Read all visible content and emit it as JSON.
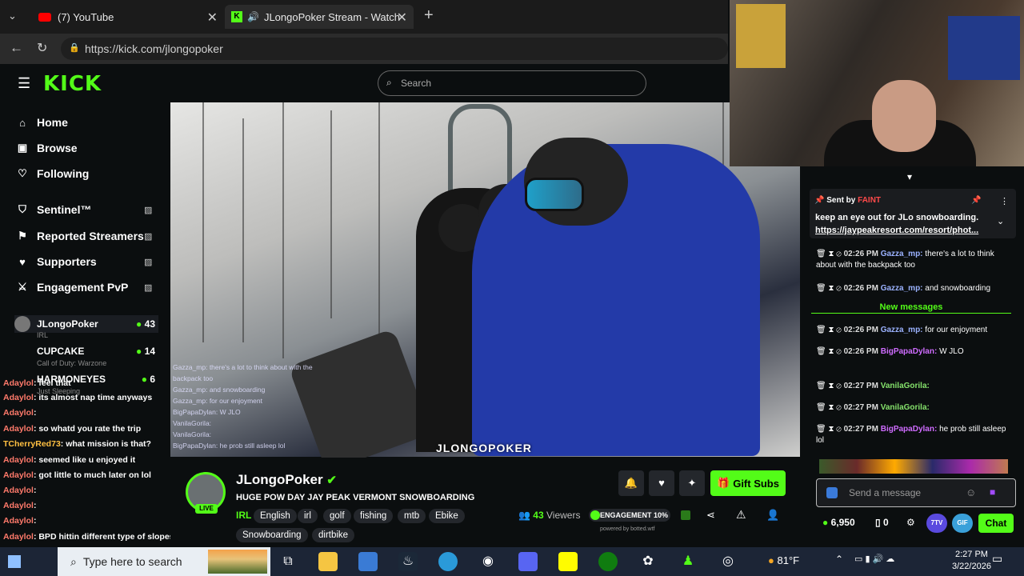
{
  "browser": {
    "tabs": [
      {
        "label": "(7) YouTube"
      },
      {
        "label": "JLongoPoker Stream - Watch"
      }
    ],
    "url": "https://kick.com/jlongopoker"
  },
  "kick": {
    "logo": "KICK",
    "search_placeholder": "Search",
    "nav": [
      {
        "label": "Home",
        "icon": "home-icon"
      },
      {
        "label": "Browse",
        "icon": "browse-icon"
      },
      {
        "label": "Following",
        "icon": "heart-icon"
      }
    ],
    "tools": [
      {
        "label": "Sentinel™",
        "icon": "shield-icon"
      },
      {
        "label": "Reported Streamers",
        "icon": "flag-icon"
      },
      {
        "label": "Supporters",
        "icon": "heart-icon"
      },
      {
        "label": "Engagement PvP",
        "icon": "swords-icon"
      }
    ],
    "channels": [
      {
        "name": "JLongoPoker",
        "sub": "IRL",
        "viewers": "43"
      },
      {
        "name": "CUPCAKE",
        "sub": "Call of Duty: Warzone",
        "viewers": "14"
      },
      {
        "name": "HARMONEYES",
        "sub": "Just Sleeping",
        "viewers": "6"
      }
    ]
  },
  "side_chat": [
    {
      "user": "Adaylol",
      "text": ": feel that"
    },
    {
      "user": "Adaylol",
      "text": ": its almost nap time anyways"
    },
    {
      "user": "Adaylol",
      "text": ":"
    },
    {
      "user": "Adaylol",
      "text": ": so whatd you rate the trip"
    },
    {
      "user": "TCherryRed73",
      "text": ": what mission is that?"
    },
    {
      "user": "Adaylol",
      "text": ": seemed like u enjoyed it"
    },
    {
      "user": "Adaylol",
      "text": ": got little to much later on lol"
    },
    {
      "user": "Adaylol",
      "text": ":"
    },
    {
      "user": "Adaylol",
      "text": ":"
    },
    {
      "user": "Adaylol",
      "text": ":"
    },
    {
      "user": "Adaylol",
      "text": ": BPD hittin different type of slopes"
    },
    {
      "user": "Adaylol",
      "text": ":"
    }
  ],
  "video": {
    "watermark": "JLONGOPOKER",
    "overlay_chat": [
      "Gazza_mp: there's a lot to think about with the",
      "backpack too",
      "Gazza_mp: and snowboarding",
      "Gazza_mp: for our enjoyment",
      "BigPapaDylan: W JLO",
      "VanilaGorila:",
      "VanilaGorila:",
      "BigPapaDylan: he prob still asleep lol"
    ]
  },
  "stream": {
    "name": "JLongoPoker",
    "live": "LIVE",
    "title": "HUGE POW DAY JAY PEAK VERMONT SNOWBOARDING",
    "category": "IRL",
    "tags": [
      "English",
      "irl",
      "golf",
      "fishing",
      "mtb",
      "Ebike",
      "Snowboarding",
      "dirtbike"
    ],
    "viewers": "43",
    "viewers_label": "Viewers",
    "engagement": "ENGAGEMENT 10%",
    "powered": "powered by botted.wtf",
    "gift_subs": "Gift Subs"
  },
  "chat": {
    "pinned_by": "Sent by",
    "pinned_user": "FAINT",
    "pinned_text": "keep an eye out for JLo snowboarding.",
    "pinned_link": "https://jaypeakresort.com/resort/phot...",
    "messages_before": [
      {
        "time": "02:26 PM",
        "user": "Gazza_mp:",
        "text": "there's a lot to think about with the backpack too"
      },
      {
        "time": "02:26 PM",
        "user": "Gazza_mp:",
        "text": "and snowboarding"
      }
    ],
    "new_messages": "New messages",
    "messages_after": [
      {
        "time": "02:26 PM",
        "user": "Gazza_mp:",
        "text": "for our enjoyment"
      },
      {
        "time": "02:26 PM",
        "user": "BigPapaDylan:",
        "text": "W JLO"
      },
      {
        "time": "02:27 PM",
        "user": "VanilaGorila:",
        "text": ""
      },
      {
        "time": "02:27 PM",
        "user": "VanilaGorila:",
        "text": ""
      },
      {
        "time": "02:27 PM",
        "user": "BigPapaDylan:",
        "text": "he prob still asleep lol"
      }
    ],
    "input_placeholder": "Send a message",
    "points": "6,950",
    "zero": "0",
    "chat_button": "Chat"
  },
  "taskbar": {
    "search_placeholder": "Type here to search",
    "temperature": "81°F",
    "time": "2:27 PM",
    "date": "3/22/2026"
  }
}
